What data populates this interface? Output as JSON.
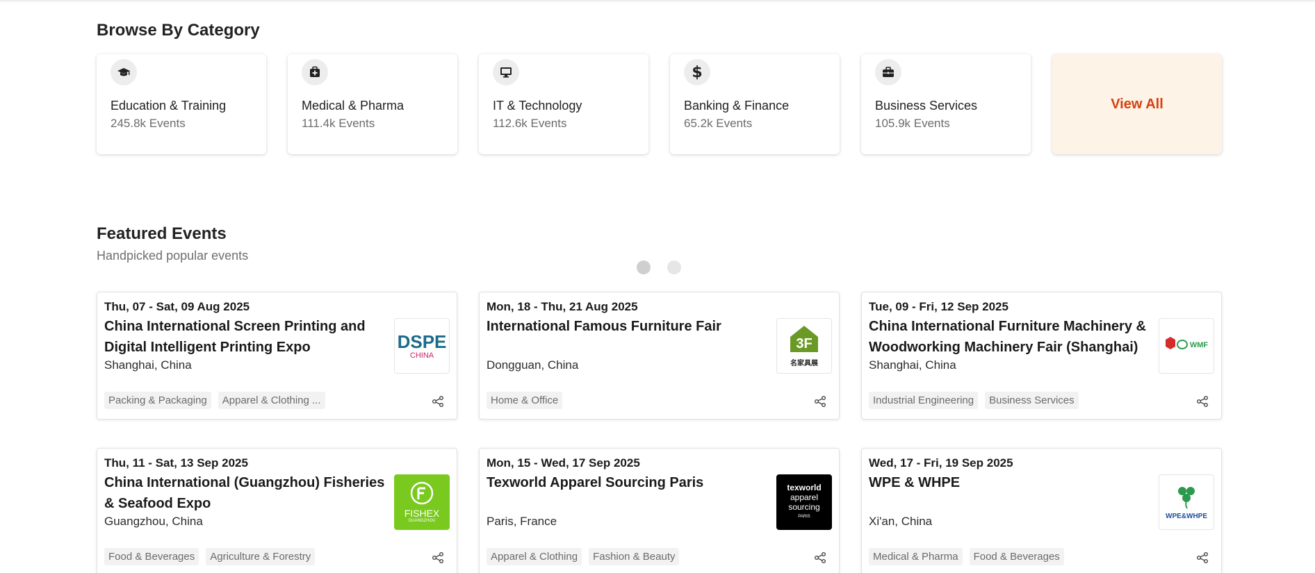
{
  "browse": {
    "title": "Browse By Category",
    "categories": [
      {
        "name": "Education & Training",
        "count": "245.8k Events",
        "icon": "graduation-cap-icon"
      },
      {
        "name": "Medical & Pharma",
        "count": "111.4k Events",
        "icon": "medical-kit-icon"
      },
      {
        "name": "IT & Technology",
        "count": "112.6k Events",
        "icon": "monitor-icon"
      },
      {
        "name": "Banking & Finance",
        "count": "65.2k Events",
        "icon": "dollar-icon"
      },
      {
        "name": "Business Services",
        "count": "105.9k Events",
        "icon": "briefcase-icon"
      }
    ],
    "view_all": "View All"
  },
  "featured": {
    "title": "Featured Events",
    "subtitle": "Handpicked popular events",
    "events": [
      {
        "date": "Thu, 07 - Sat, 09 Aug 2025",
        "title": "China International Screen Printing and Digital Intelligent Printing Expo",
        "location": "Shanghai, China",
        "tags": [
          "Packing & Packaging",
          "Apparel & Clothing ..."
        ],
        "logo": {
          "line1": "DSPE",
          "line2": "CHINA"
        }
      },
      {
        "date": "Mon, 18 - Thu, 21 Aug 2025",
        "title": "International Famous Furniture Fair",
        "location": "Dongguan, China",
        "tags": [
          "Home & Office"
        ],
        "logo": {
          "line1": "3F",
          "line2": "名家具展"
        }
      },
      {
        "date": "Tue, 09 - Fri, 12 Sep 2025",
        "title": "China International Furniture Machinery & Woodworking Machinery Fair (Shanghai)",
        "location": "Shanghai, China",
        "tags": [
          "Industrial Engineering",
          "Business Services"
        ],
        "logo": {
          "line1": "WMF",
          "line2": ""
        }
      },
      {
        "date": "Thu, 11 - Sat, 13 Sep 2025",
        "title": "China International (Guangzhou) Fisheries & Seafood Expo",
        "location": "Guangzhou, China",
        "tags": [
          "Food & Beverages",
          "Agriculture & Forestry"
        ],
        "logo": {
          "line1": "FISHEX",
          "line2": "GUANGZHOU"
        }
      },
      {
        "date": "Mon, 15 - Wed, 17 Sep 2025",
        "title": "Texworld Apparel Sourcing Paris",
        "location": "Paris, France",
        "tags": [
          "Apparel & Clothing",
          "Fashion & Beauty"
        ],
        "logo": {
          "line1": "texworld",
          "line2": "apparel",
          "line3": "sourcing",
          "line4": "PARIS"
        }
      },
      {
        "date": "Wed, 17 - Fri, 19 Sep 2025",
        "title": "WPE & WHPE",
        "location": "Xi'an, China",
        "tags": [
          "Medical & Pharma",
          "Food & Beverages"
        ],
        "logo": {
          "line1": "WPE&WHPE"
        }
      }
    ]
  },
  "colors": {
    "accent": "#d6400f",
    "view_all_bg": "#fdf3e7"
  }
}
